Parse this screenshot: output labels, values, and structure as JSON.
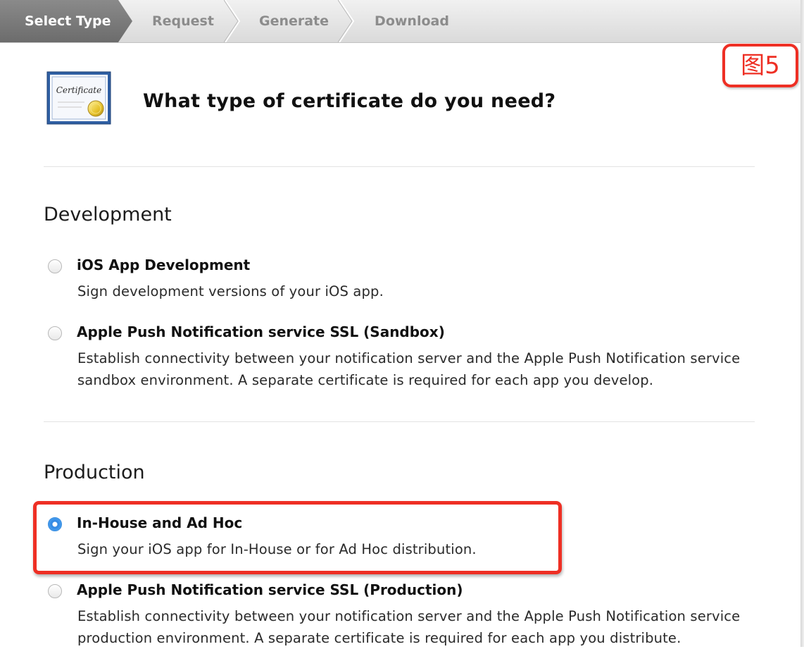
{
  "wizard": {
    "steps": [
      "Select Type",
      "Request",
      "Generate",
      "Download"
    ],
    "active_step": "Select Type"
  },
  "header": {
    "title": "What type of certificate do you need?",
    "icon_text": "Certificate"
  },
  "figure_label": "图5",
  "sections": [
    {
      "title": "Development",
      "options": [
        {
          "title": "iOS App Development",
          "description": "Sign development versions of your iOS app.",
          "selected": false
        },
        {
          "title": "Apple Push Notification service SSL (Sandbox)",
          "description": "Establish connectivity between your notification server and the Apple Push Notification service sandbox environment. A separate certificate is required for each app you develop.",
          "selected": false
        }
      ]
    },
    {
      "title": "Production",
      "options": [
        {
          "title": "In-House and Ad Hoc",
          "description": "Sign your iOS app for In-House or for Ad Hoc distribution.",
          "selected": true
        },
        {
          "title": "Apple Push Notification service SSL (Production)",
          "description": "Establish connectivity between your notification server and the Apple Push Notification service production environment. A separate certificate is required for each app you distribute.",
          "selected": false
        }
      ]
    }
  ],
  "colors": {
    "annotation_red": "#ee2f24",
    "radio_selected": "#2f86e2",
    "active_step_bg": "#777777"
  }
}
